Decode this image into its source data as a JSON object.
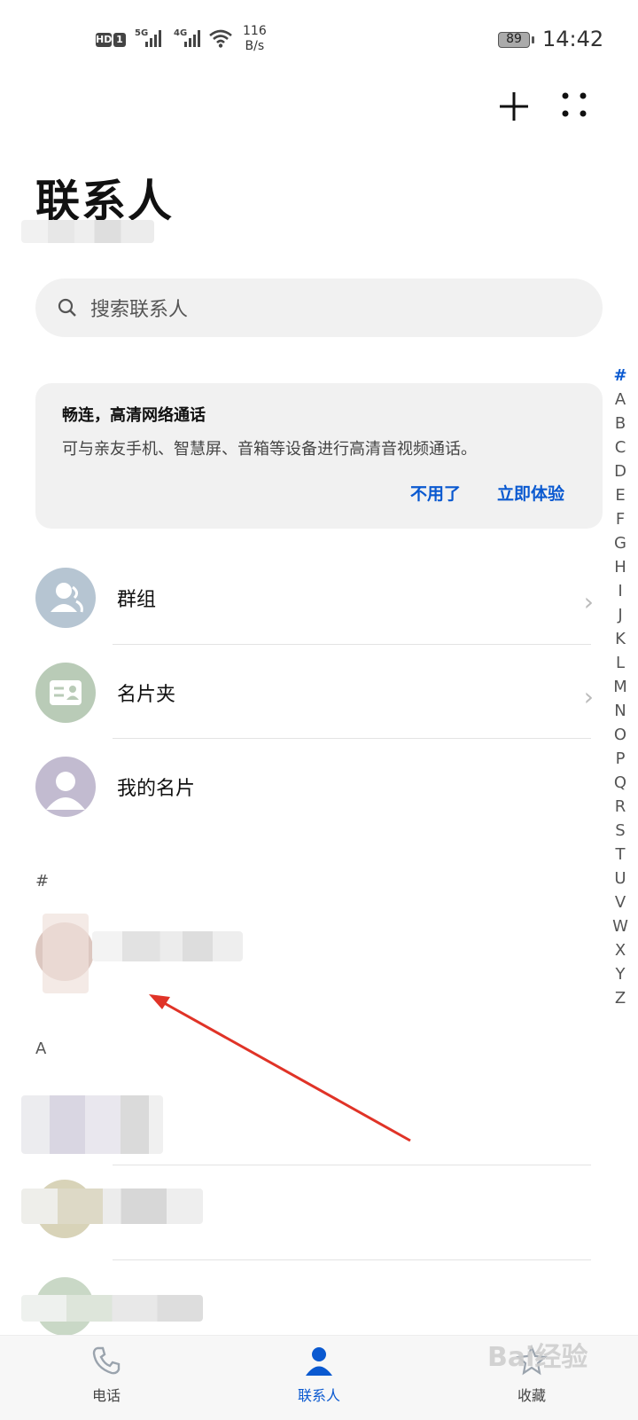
{
  "status_bar": {
    "hd_label": "HD",
    "sim_number": "1",
    "network_1": "5G",
    "network_2": "4G",
    "net_speed_value": "116",
    "net_speed_unit": "B/s",
    "battery_level": "89",
    "clock": "14:42"
  },
  "page": {
    "title": "联系人"
  },
  "search": {
    "placeholder": "搜索联系人"
  },
  "promo": {
    "title": "畅连，高清网络通话",
    "description": "可与亲友手机、智慧屏、音箱等设备进行高清音视频通话。",
    "dismiss_label": "不用了",
    "try_label": "立即体验"
  },
  "menu": {
    "groups_label": "群组",
    "card_holder_label": "名片夹",
    "my_card_label": "我的名片"
  },
  "sections": {
    "hash_header": "#",
    "a_header": "A"
  },
  "alpha_index": [
    "#",
    "A",
    "B",
    "C",
    "D",
    "E",
    "F",
    "G",
    "H",
    "I",
    "J",
    "K",
    "L",
    "M",
    "N",
    "O",
    "P",
    "Q",
    "R",
    "S",
    "T",
    "U",
    "V",
    "W",
    "X",
    "Y",
    "Z"
  ],
  "bottom_nav": {
    "phone_label": "电话",
    "contacts_label": "联系人",
    "favorites_label": "收藏"
  },
  "watermark": "Bai经验",
  "colors": {
    "accent": "#0a59d0",
    "arrow": "#e03327"
  }
}
